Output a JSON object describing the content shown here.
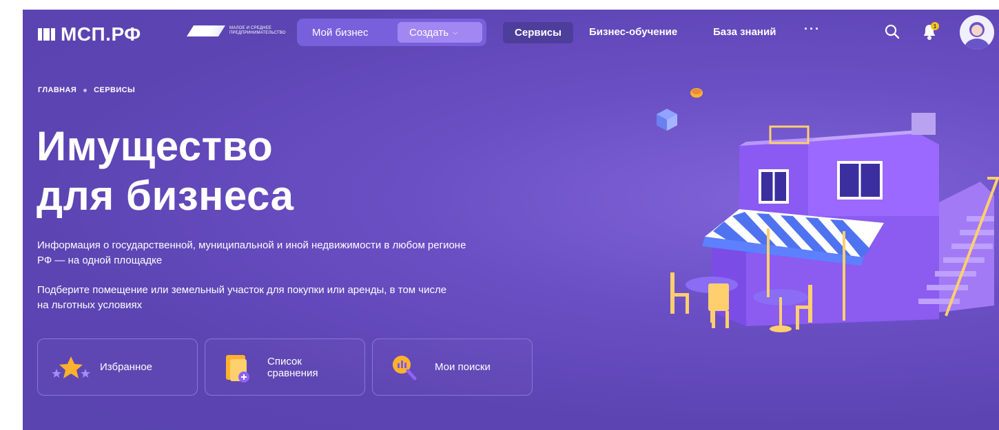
{
  "header": {
    "logo_text": "МСП.РФ",
    "partner_line1": "МАЛОЕ И СРЕДНЕЕ",
    "partner_line2": "ПРЕДПРИНИМАТЕЛЬСТВО",
    "nav_my_business": "Мой бизнес",
    "nav_create": "Создать",
    "nav_services": "Сервисы",
    "nav_business_training": "Бизнес-обучение",
    "nav_knowledge_base": "База знаний",
    "nav_more": "···",
    "notification_count": "1"
  },
  "breadcrumbs": [
    "ГЛАВНАЯ",
    "СЕРВИСЫ"
  ],
  "hero": {
    "title_line1": "Имущество",
    "title_line2": "для бизнеса",
    "desc1_line1": "Информация о государственной, муниципальной и иной недвижимости в любом регионе",
    "desc1_line2": "РФ — на одной площадке",
    "desc2_line1": "Подберите помещение или земельный участок для покупки или аренды, в том числе",
    "desc2_line2": "на льготных условиях"
  },
  "cards": {
    "favorites": "Избранное",
    "compare_line1": "Список",
    "compare_line2": "сравнения",
    "searches": "Мои поиски"
  },
  "colors": {
    "background": "#5c44b2",
    "accent": "#a187f2",
    "services_active": "#4d3e9c",
    "badge": "#f5c518"
  }
}
